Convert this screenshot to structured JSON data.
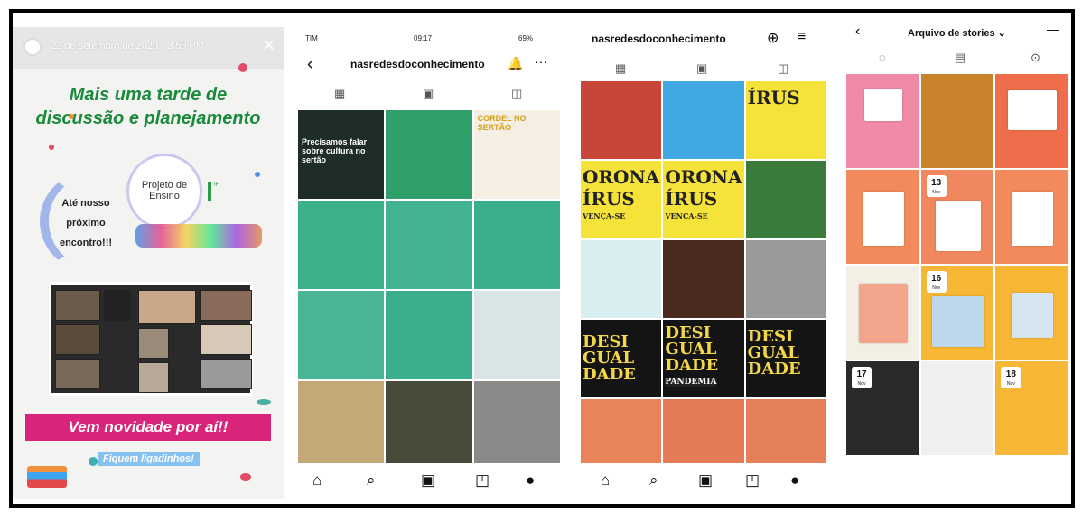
{
  "story": {
    "date": "22 de setembro de 2020 · 3:55 PM",
    "close_icon": "×",
    "title_line1": "Mais uma tarde de",
    "title_line2": "discussão e planejamento",
    "projeto": "Projeto de Ensino",
    "ate_nosso": "Até nosso próximo encontro!!!",
    "novidade": "Vem novidade por aí!!",
    "fiquem": "Fiquem ligadinhos!",
    "colors": {
      "title": "#1a8a3c",
      "banner": "#d8247a"
    }
  },
  "profile": {
    "carrier": "TIM",
    "time": "09:17",
    "battery": "69%",
    "username": "nasredesdoconhecimento",
    "tabs": [
      "grid-icon",
      "reels-icon",
      "tagged-icon"
    ],
    "posts": [
      "Precisamos falar sobre cultura no sertão",
      "",
      "CORDEL NO SERTÃO"
    ],
    "nav": [
      "home-icon",
      "search-icon",
      "reels-icon",
      "shop-icon",
      "profile-icon"
    ]
  },
  "profile2": {
    "username": "nasredesdoconhecimento",
    "posts": {
      "virus": "ÍRUS",
      "corona1": "ORONA",
      "corona2": "ÍRUS",
      "corona_sub": "VENÇA-SE",
      "desi": "DESI",
      "gual": "GUAL",
      "dade": "DADE",
      "pandemia": "PANDEMIA"
    }
  },
  "archive": {
    "title": "Arquivo de stories",
    "dates": [
      {
        "day": "13",
        "month": "Nov"
      },
      {
        "day": "16",
        "month": "Nov"
      },
      {
        "day": "17",
        "month": "Nov"
      },
      {
        "day": "18",
        "month": "Nov"
      }
    ]
  }
}
